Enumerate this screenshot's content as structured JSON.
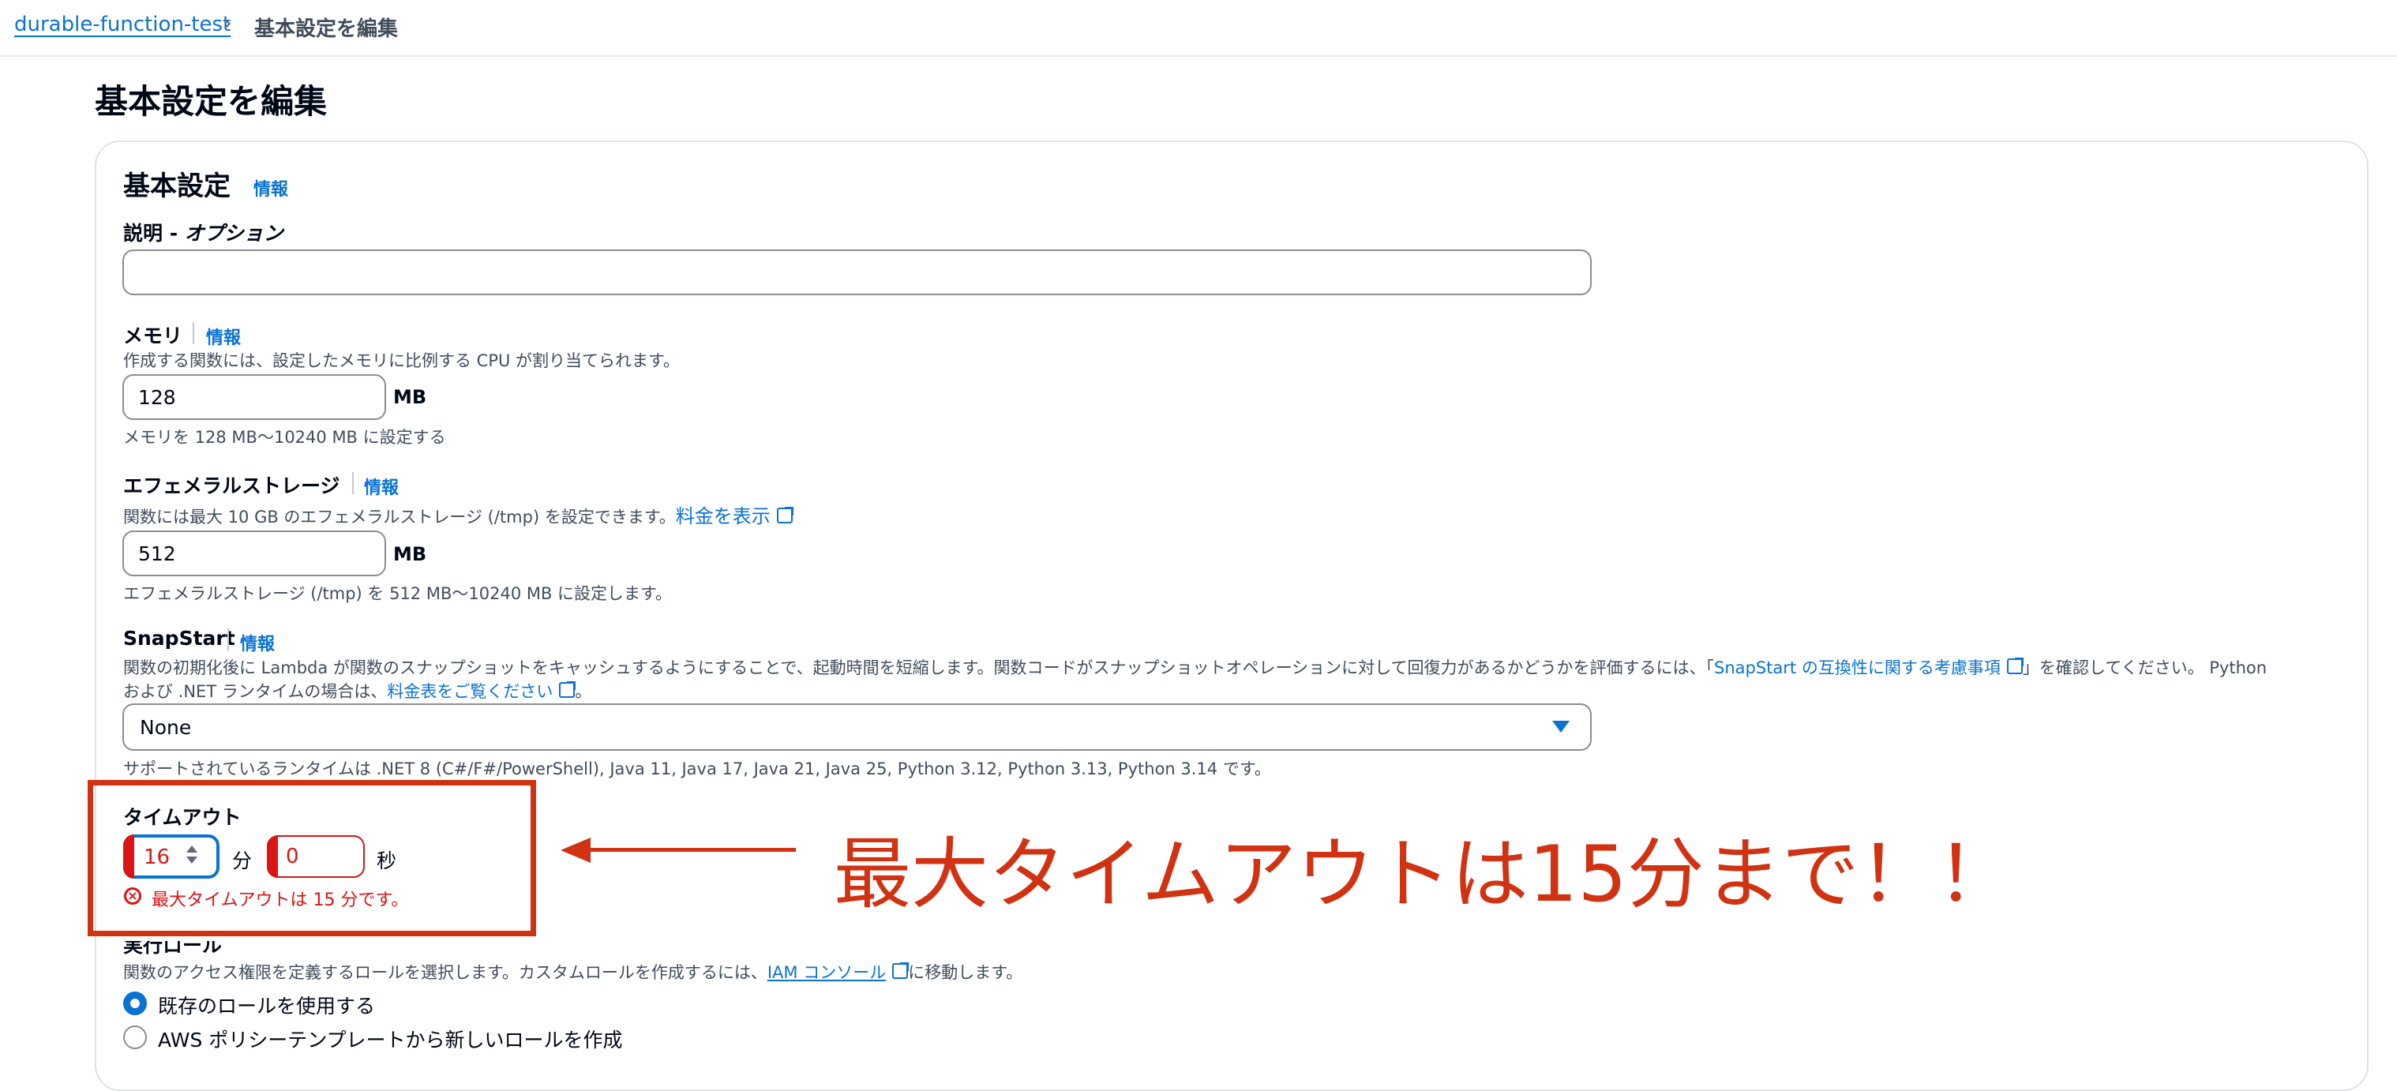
{
  "breadcrumb": {
    "parent": "durable-function-test",
    "current": "基本設定を編集"
  },
  "page": {
    "title": "基本設定を編集"
  },
  "section": {
    "title": "基本設定",
    "info": "情報"
  },
  "description": {
    "label": "説明 - ",
    "label_optional": "オプション",
    "value": ""
  },
  "memory": {
    "label": "メモリ",
    "info": "情報",
    "desc": "作成する関数には、設定したメモリに比例する CPU が割り当てられます。",
    "value": "128",
    "unit": "MB",
    "hint": "メモリを 128 MB〜10240 MB に設定する"
  },
  "ephemeral": {
    "label": "エフェメラルストレージ",
    "info": "情報",
    "desc": "関数には最大 10 GB のエフェメラルストレージ (/tmp) を設定できます。",
    "pricing_link": "料金を表示",
    "value": "512",
    "unit": "MB",
    "hint": "エフェメラルストレージ (/tmp) を 512 MB〜10240 MB に設定します。"
  },
  "snapstart": {
    "label": "SnapStart",
    "info": "情報",
    "desc_a": "関数の初期化後に Lambda が関数のスナップショットをキャッシュするようにすることで、起動時間を短縮します。関数コードがスナップショットオペレーションに対して回復力があるかどうかを評価するには、「",
    "compat_link": "SnapStart の互換性に関する考慮事項",
    "desc_b": "」を確認してください。 Python",
    "desc_c": "および .NET ランタイムの場合は、",
    "pricing_link": "料金表をご覧ください",
    "desc_d": "。",
    "selected": "None",
    "hint": "サポートされているランタイムは .NET 8 (C#/F#/PowerShell), Java 11, Java 17, Java 21, Java 25, Python 3.12, Python 3.13, Python 3.14 です。"
  },
  "timeout": {
    "label": "タイムアウト",
    "minutes": "16",
    "minutes_unit": "分",
    "seconds": "0",
    "seconds_unit": "秒",
    "error": "最大タイムアウトは 15 分です。"
  },
  "annotation": {
    "text": "最大タイムアウトは15分まで！！",
    "color": "#d13212"
  },
  "role": {
    "label": "実行ロール",
    "desc_a": "関数のアクセス権限を定義するロールを選択します。カスタムロールを作成するには、",
    "iam_link": "IAM コンソール",
    "desc_b": "に移動します。",
    "options": [
      "既存のロールを使用する",
      "AWS ポリシーテンプレートから新しいロールを作成"
    ]
  }
}
